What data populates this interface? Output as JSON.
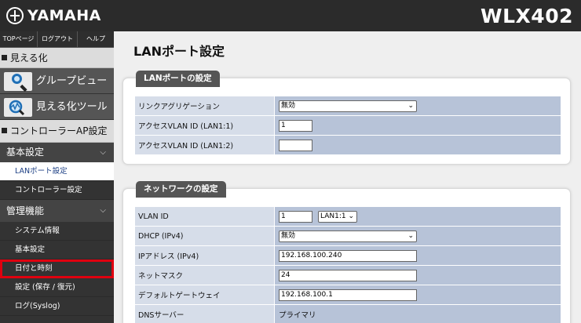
{
  "header": {
    "logo_text": "YAMAHA",
    "model": "WLX402"
  },
  "sidebar": {
    "topnav": [
      "TOPページ",
      "ログアウト",
      "ヘルプ"
    ],
    "section_visualize": "見える化",
    "tools": [
      {
        "label": "グループビュー",
        "icon": "magnifier-icon"
      },
      {
        "label": "見える化ツール",
        "icon": "visualize-tool-icon"
      }
    ],
    "section_controller": "コントローラーAP設定",
    "group_basic": "基本設定",
    "basic_items": [
      "LANポート設定",
      "コントローラー設定"
    ],
    "group_admin": "管理機能",
    "admin_items": [
      "システム情報",
      "基本設定",
      "日付と時刻",
      "設定 (保存 / 復元)",
      "ログ(Syslog)"
    ],
    "active_item": "LANポート設定",
    "highlighted_item": "日付と時刻"
  },
  "main": {
    "page_title": "LANポート設定",
    "lan_panel": {
      "title": "LANポートの設定",
      "rows": [
        {
          "label": "リンクアグリゲーション",
          "value": "無効"
        },
        {
          "label": "アクセスVLAN ID (LAN1:1)",
          "value": "1"
        },
        {
          "label": "アクセスVLAN ID (LAN1:2)",
          "value": ""
        }
      ]
    },
    "net_panel": {
      "title": "ネットワークの設定",
      "rows": [
        {
          "label": "VLAN ID",
          "value": "1",
          "select": "LAN1:1"
        },
        {
          "label": "DHCP (IPv4)",
          "value": "無効"
        },
        {
          "label": "IPアドレス (IPv4)",
          "value": "192.168.100.240"
        },
        {
          "label": "ネットマスク",
          "value": "24"
        },
        {
          "label": "デフォルトゲートウェイ",
          "value": "192.168.100.1"
        },
        {
          "label": "DNSサーバー",
          "value": "プライマリ"
        }
      ]
    }
  },
  "colors": {
    "header_bg": "#2b2b2b",
    "highlight": "#e0000f",
    "label_cell": "#d6dde9",
    "value_cell": "#b7c3d8"
  }
}
